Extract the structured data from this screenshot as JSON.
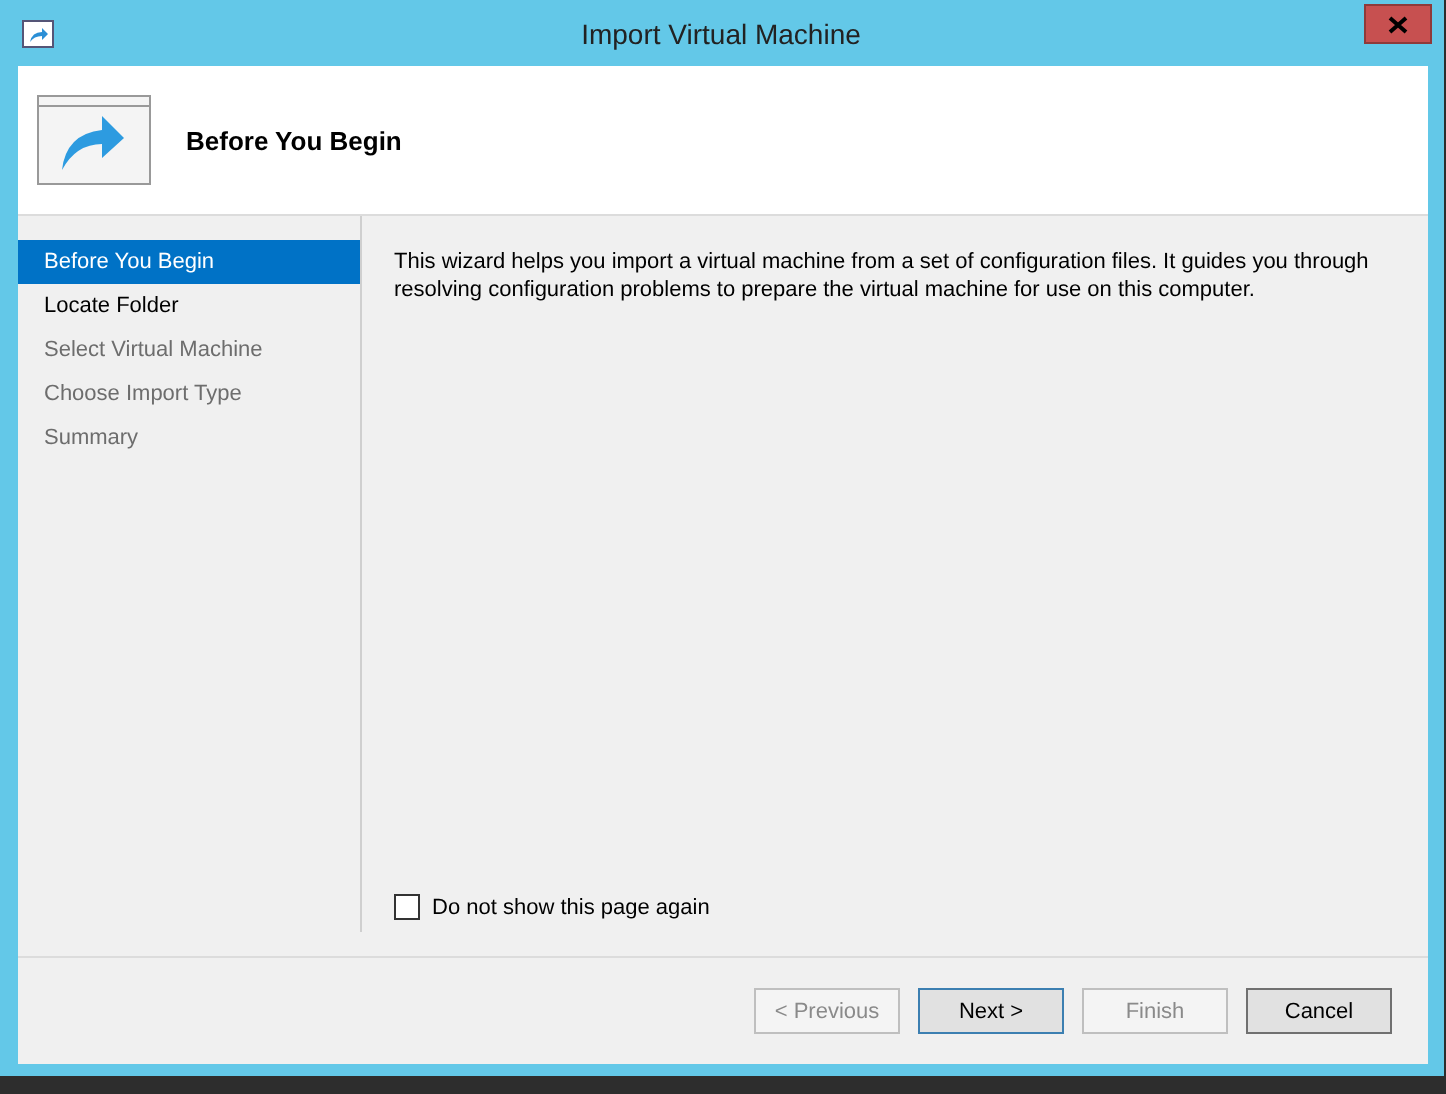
{
  "window": {
    "title": "Import Virtual Machine"
  },
  "header": {
    "title": "Before You Begin"
  },
  "steps": [
    {
      "label": "Before You Begin",
      "selected": true,
      "disabled": false
    },
    {
      "label": "Locate Folder",
      "selected": false,
      "disabled": false
    },
    {
      "label": "Select Virtual Machine",
      "selected": false,
      "disabled": true
    },
    {
      "label": "Choose Import Type",
      "selected": false,
      "disabled": true
    },
    {
      "label": "Summary",
      "selected": false,
      "disabled": true
    }
  ],
  "description": "This wizard helps you import a virtual machine from a set of configuration files. It guides you through resolving configuration problems to prepare the virtual machine for use on this computer.",
  "dont_show_again": {
    "label": "Do not show this page again",
    "checked": false
  },
  "buttons": [
    {
      "label": "< Previous",
      "disabled": true,
      "default": false
    },
    {
      "label": "Next >",
      "disabled": false,
      "default": true
    },
    {
      "label": "Finish",
      "disabled": true,
      "default": false
    },
    {
      "label": "Cancel",
      "disabled": false,
      "default": false
    }
  ]
}
